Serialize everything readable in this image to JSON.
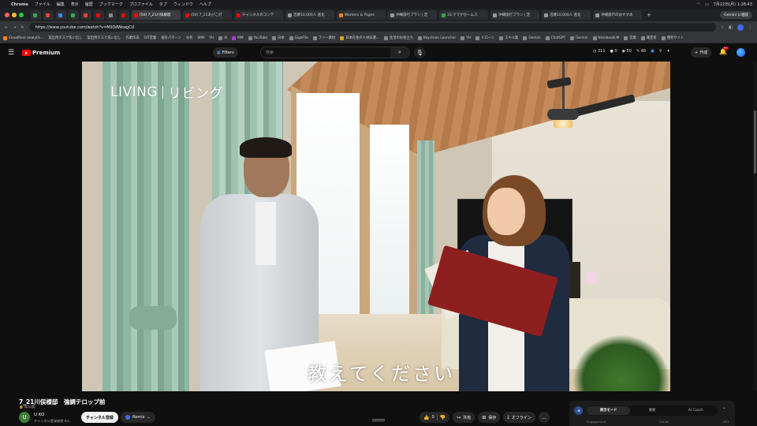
{
  "mac_menu": {
    "apple": "",
    "items": [
      "Chrome",
      "ファイル",
      "編集",
      "表示",
      "履歴",
      "ブックマーク",
      "プロファイル",
      "タブ",
      "ウィンドウ",
      "ヘルプ"
    ],
    "clock": "7月22日(月) 1:28:43"
  },
  "tabs": [
    {
      "label": "",
      "color": "#34a853"
    },
    {
      "label": "",
      "color": "#ea4335"
    },
    {
      "label": "",
      "color": "#4285f4"
    },
    {
      "label": "",
      "color": "#34a853"
    },
    {
      "label": "",
      "color": "#ea4335"
    },
    {
      "label": "",
      "color": "#ff0000"
    },
    {
      "label": "",
      "color": "#888888"
    },
    {
      "label": "",
      "color": "#ff0000"
    },
    {
      "label": "(50) 7_21川俣様邸",
      "color": "#ff0000",
      "active": true
    },
    {
      "label": "(50) 7_21あびこ打",
      "color": "#ff0000"
    },
    {
      "label": "チャンネルのコンテ",
      "color": "#ff0000"
    },
    {
      "label": "活躍10,000人 進化",
      "color": "#999999"
    },
    {
      "label": "Workers & Pages",
      "color": "#f48120"
    },
    {
      "label": "沖縄旅行プラン | 定",
      "color": "#999999"
    },
    {
      "label": "33.ママがホームス",
      "color": "#34a853"
    },
    {
      "label": "沖縄旅行プラン | 定",
      "color": "#999999"
    },
    {
      "label": "活躍10,000人 進化",
      "color": "#999999"
    },
    {
      "label": "沖縄旅行のおすすめ",
      "color": "#999999"
    }
  ],
  "gemini_button": "Gemini に相談",
  "address_bar": {
    "url": "https://www.youtube.com/watch?v=M93dWoagCU"
  },
  "bookmarks": [
    "Cloudflare analytic...",
    "案出用タスク洗い出し",
    "案出用タスク洗い出し",
    "作業作成",
    "GIT定義",
    "値をパターン",
    "分析",
    "WIN",
    "YH",
    "Vi",
    "MM",
    "YouTube",
    "日本",
    "GigaFile",
    "フリー素材",
    "日本在住の人材派遣...",
    "生活のお役立ち",
    "Keychron Launcher",
    "YH",
    "ドローン",
    "スキル集",
    "Gemini",
    "ChatGPT",
    "Gemini",
    "NotebookLM",
    "営業",
    "確定者",
    "便利サイト"
  ],
  "yt_header": {
    "logo_text": "Premium",
    "filters_label": "Filters",
    "search_placeholder": "検索",
    "stats": [
      "311",
      "0",
      "50",
      "48"
    ],
    "create_label": "作成",
    "bell_badge": "9+"
  },
  "video": {
    "overlay_title_en": "LIVING",
    "overlay_title_jp": "リビング",
    "subtitle": "教えてください"
  },
  "below_player": {
    "title": "7_21川俣様邸　強調テロップ前",
    "visibility": "非公開",
    "channel_initial": "U",
    "channel_name": "U KO",
    "channel_subs": "チャンネル登録者数 8人",
    "subscribe_label": "チャンネル登録",
    "remix_label": "Remix",
    "like_count": "0",
    "share_label": "共有",
    "save_label": "保存",
    "offline_label": "オフライン",
    "more_label": "…"
  },
  "side_panel": {
    "segments": [
      "表示モード",
      "要素",
      "AI Coach"
    ],
    "active_segment": 0,
    "labels": [
      "Engagement",
      "Outlier",
      "VPH"
    ]
  },
  "colors": {
    "accent_red": "#ff0000",
    "bg": "#0f0f0f",
    "chip": "#272727"
  }
}
